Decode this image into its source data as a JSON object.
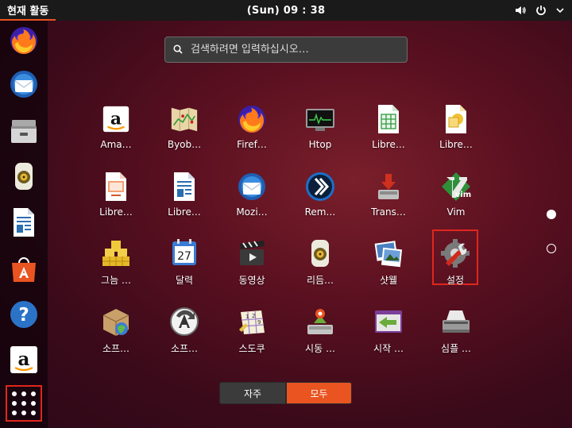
{
  "topbar": {
    "activities": "현재 활동",
    "clock": "(Sun) 09 : 38",
    "volume_icon": "speaker-icon",
    "power_icon": "power-icon",
    "menu_icon": "chevron-down-icon"
  },
  "dock": {
    "items": [
      {
        "name": "firefox",
        "icon": "firefox-icon"
      },
      {
        "name": "thunderbird",
        "icon": "thunderbird-icon"
      },
      {
        "name": "files",
        "icon": "file-cabinet-icon"
      },
      {
        "name": "rhythmbox",
        "icon": "speaker-device-icon"
      },
      {
        "name": "writer",
        "icon": "document-writer-icon"
      },
      {
        "name": "software",
        "icon": "shopping-bag-icon"
      },
      {
        "name": "help",
        "icon": "help-icon"
      },
      {
        "name": "amazon",
        "icon": "amazon-icon"
      }
    ],
    "show_apps_icon": "app-grid-icon"
  },
  "search": {
    "placeholder": "검색하려면 입력하십시오…"
  },
  "apps": [
    {
      "label": "Ama…",
      "icon": "amazon-icon"
    },
    {
      "label": "Byob…",
      "icon": "byobu-map-icon"
    },
    {
      "label": "Firef…",
      "icon": "firefox-icon"
    },
    {
      "label": "Htop",
      "icon": "htop-monitor-icon"
    },
    {
      "label": "Libre…",
      "icon": "libreoffice-calc-icon"
    },
    {
      "label": "Libre…",
      "icon": "libreoffice-draw-icon"
    },
    {
      "label": "Libre…",
      "icon": "libreoffice-impress-icon"
    },
    {
      "label": "Libre…",
      "icon": "libreoffice-writer-icon"
    },
    {
      "label": "Mozi…",
      "icon": "thunderbird-icon"
    },
    {
      "label": "Rem…",
      "icon": "remmina-icon"
    },
    {
      "label": "Trans…",
      "icon": "transmission-icon"
    },
    {
      "label": "Vim",
      "icon": "vim-icon"
    },
    {
      "label": "그늠 …",
      "icon": "mahjongg-icon"
    },
    {
      "label": "달력",
      "icon": "calendar-icon"
    },
    {
      "label": "동영상",
      "icon": "video-clapper-icon"
    },
    {
      "label": "리듬…",
      "icon": "rhythmbox-icon"
    },
    {
      "label": "샷웰",
      "icon": "shotwell-photo-icon"
    },
    {
      "label": "설정",
      "icon": "settings-tools-icon"
    },
    {
      "label": "소프…",
      "icon": "software-package-icon"
    },
    {
      "label": "소프…",
      "icon": "software-update-icon"
    },
    {
      "label": "스도쿠",
      "icon": "sudoku-icon"
    },
    {
      "label": "시동 …",
      "icon": "startup-disk-icon"
    },
    {
      "label": "시작 …",
      "icon": "startup-applications-icon"
    },
    {
      "label": "심플 …",
      "icon": "scanner-icon"
    }
  ],
  "selected_app": "설정",
  "pager": {
    "current_page": 1,
    "total_pages": 2
  },
  "toggle": {
    "frequent_label": "자주",
    "all_label": "모두",
    "active": "모두"
  },
  "colors": {
    "accent": "#e95420",
    "highlight_border": "#e0261d",
    "topbar": "#1a1a1a"
  }
}
